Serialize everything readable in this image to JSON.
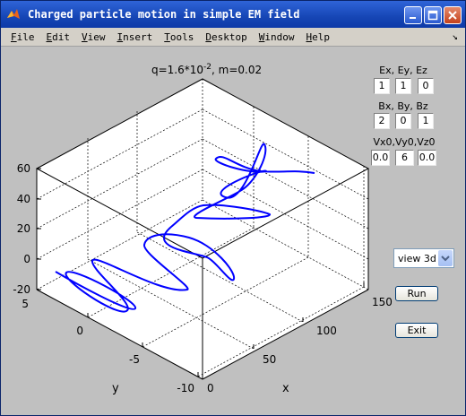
{
  "window": {
    "title": "Charged particle motion in simple EM field"
  },
  "menu": [
    "File",
    "Edit",
    "View",
    "Insert",
    "Tools",
    "Desktop",
    "Window",
    "Help"
  ],
  "controls": {
    "e_label": "Ex, Ey, Ez",
    "e_values": [
      "1",
      "1",
      "0"
    ],
    "b_label": "Bx, By, Bz",
    "b_values": [
      "2",
      "0",
      "1"
    ],
    "v_label": "Vx0,Vy0,Vz0",
    "v_values": [
      "0.0",
      "6",
      "0.0"
    ],
    "view_select": "view 3d",
    "run_label": "Run",
    "exit_label": "Exit"
  },
  "plot": {
    "title_prefix": "q=1.6*10",
    "title_exp": "-2",
    "title_suffix": ", m=0.02",
    "z_ticks": [
      "60",
      "40",
      "20",
      "0",
      "-20"
    ],
    "y_ticks": [
      "5",
      "0",
      "-5",
      "-10"
    ],
    "x_ticks": [
      "0",
      "50",
      "100",
      "150"
    ],
    "xlabel": "x",
    "ylabel": "y",
    "line_color": "#0000ff"
  }
}
